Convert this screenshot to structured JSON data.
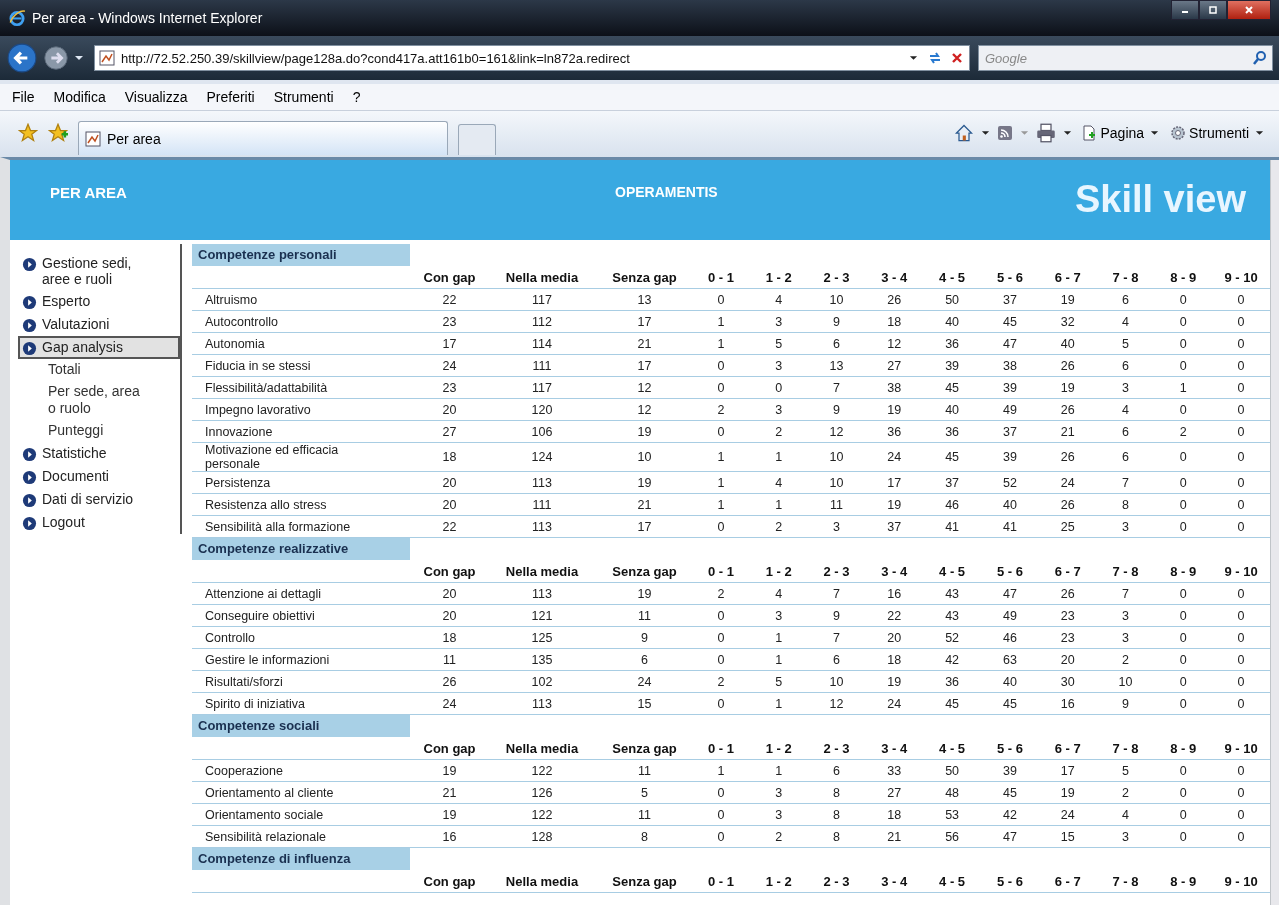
{
  "window": {
    "title": "Per area - Windows Internet Explorer"
  },
  "address_bar": {
    "url": "http://72.52.250.39/skillview/page128a.do?cond417a.att161b0=161&link=ln872a.redirect"
  },
  "search": {
    "placeholder": "Google"
  },
  "menu": [
    "File",
    "Modifica",
    "Visualizza",
    "Preferiti",
    "Strumenti",
    "?"
  ],
  "tabs": [
    {
      "label": "Per area",
      "selected": true
    }
  ],
  "toolbar": {
    "page_button": "Pagina",
    "tools_button": "Strumenti"
  },
  "page_header": {
    "section": "PER AREA",
    "company": "OPERAMENTIS",
    "logo": "Skill view"
  },
  "sidebar": {
    "items": [
      {
        "label": "Gestione sedi, aree e ruoli",
        "selected": false
      },
      {
        "label": "Esperto",
        "selected": false
      },
      {
        "label": "Valutazioni",
        "selected": false
      },
      {
        "label": "Gap analysis",
        "selected": true,
        "children": [
          {
            "label": "Totali",
            "selected": false
          },
          {
            "label": "Per sede, area o ruolo",
            "selected": false
          },
          {
            "label": "Punteggi",
            "selected": false
          }
        ]
      },
      {
        "label": "Statistiche",
        "selected": false
      },
      {
        "label": "Documenti",
        "selected": false
      },
      {
        "label": "Dati di servizio",
        "selected": false
      },
      {
        "label": "Logout",
        "selected": false
      }
    ]
  },
  "sections": [
    {
      "title": "Competenze personali",
      "columns": [
        "Con gap",
        "Nella media",
        "Senza gap",
        "0 - 1",
        "1 - 2",
        "2 - 3",
        "3 - 4",
        "4 - 5",
        "5 - 6",
        "6 - 7",
        "7 - 8",
        "8 - 9",
        "9 - 10"
      ],
      "rows": [
        {
          "name": "Altruismo",
          "values": [
            "22",
            "117",
            "13",
            "0",
            "4",
            "10",
            "26",
            "50",
            "37",
            "19",
            "6",
            "0",
            "0"
          ]
        },
        {
          "name": "Autocontrollo",
          "values": [
            "23",
            "112",
            "17",
            "1",
            "3",
            "9",
            "18",
            "40",
            "45",
            "32",
            "4",
            "0",
            "0"
          ]
        },
        {
          "name": "Autonomia",
          "values": [
            "17",
            "114",
            "21",
            "1",
            "5",
            "6",
            "12",
            "36",
            "47",
            "40",
            "5",
            "0",
            "0"
          ]
        },
        {
          "name": "Fiducia in se stessi",
          "values": [
            "24",
            "111",
            "17",
            "0",
            "3",
            "13",
            "27",
            "39",
            "38",
            "26",
            "6",
            "0",
            "0"
          ]
        },
        {
          "name": "Flessibilità/adattabilità",
          "values": [
            "23",
            "117",
            "12",
            "0",
            "0",
            "7",
            "38",
            "45",
            "39",
            "19",
            "3",
            "1",
            "0"
          ]
        },
        {
          "name": "Impegno lavorativo",
          "values": [
            "20",
            "120",
            "12",
            "2",
            "3",
            "9",
            "19",
            "40",
            "49",
            "26",
            "4",
            "0",
            "0"
          ]
        },
        {
          "name": "Innovazione",
          "values": [
            "27",
            "106",
            "19",
            "0",
            "2",
            "12",
            "36",
            "36",
            "37",
            "21",
            "6",
            "2",
            "0"
          ]
        },
        {
          "name": "Motivazione ed efficacia personale",
          "values": [
            "18",
            "124",
            "10",
            "1",
            "1",
            "10",
            "24",
            "45",
            "39",
            "26",
            "6",
            "0",
            "0"
          ]
        },
        {
          "name": "Persistenza",
          "values": [
            "20",
            "113",
            "19",
            "1",
            "4",
            "10",
            "17",
            "37",
            "52",
            "24",
            "7",
            "0",
            "0"
          ]
        },
        {
          "name": "Resistenza allo stress",
          "values": [
            "20",
            "111",
            "21",
            "1",
            "1",
            "11",
            "19",
            "46",
            "40",
            "26",
            "8",
            "0",
            "0"
          ]
        },
        {
          "name": "Sensibilità alla formazione",
          "values": [
            "22",
            "113",
            "17",
            "0",
            "2",
            "3",
            "37",
            "41",
            "41",
            "25",
            "3",
            "0",
            "0"
          ]
        }
      ]
    },
    {
      "title": "Competenze realizzative",
      "columns": [
        "Con gap",
        "Nella media",
        "Senza gap",
        "0 - 1",
        "1 - 2",
        "2 - 3",
        "3 - 4",
        "4 - 5",
        "5 - 6",
        "6 - 7",
        "7 - 8",
        "8 - 9",
        "9 - 10"
      ],
      "rows": [
        {
          "name": "Attenzione ai dettagli",
          "values": [
            "20",
            "113",
            "19",
            "2",
            "4",
            "7",
            "16",
            "43",
            "47",
            "26",
            "7",
            "0",
            "0"
          ]
        },
        {
          "name": "Conseguire obiettivi",
          "values": [
            "20",
            "121",
            "11",
            "0",
            "3",
            "9",
            "22",
            "43",
            "49",
            "23",
            "3",
            "0",
            "0"
          ]
        },
        {
          "name": "Controllo",
          "values": [
            "18",
            "125",
            "9",
            "0",
            "1",
            "7",
            "20",
            "52",
            "46",
            "23",
            "3",
            "0",
            "0"
          ]
        },
        {
          "name": "Gestire le informazioni",
          "values": [
            "11",
            "135",
            "6",
            "0",
            "1",
            "6",
            "18",
            "42",
            "63",
            "20",
            "2",
            "0",
            "0"
          ]
        },
        {
          "name": "Risultati/sforzi",
          "values": [
            "26",
            "102",
            "24",
            "2",
            "5",
            "10",
            "19",
            "36",
            "40",
            "30",
            "10",
            "0",
            "0"
          ]
        },
        {
          "name": "Spirito di iniziativa",
          "values": [
            "24",
            "113",
            "15",
            "0",
            "1",
            "12",
            "24",
            "45",
            "45",
            "16",
            "9",
            "0",
            "0"
          ]
        }
      ]
    },
    {
      "title": "Competenze sociali",
      "columns": [
        "Con gap",
        "Nella media",
        "Senza gap",
        "0 - 1",
        "1 - 2",
        "2 - 3",
        "3 - 4",
        "4 - 5",
        "5 - 6",
        "6 - 7",
        "7 - 8",
        "8 - 9",
        "9 - 10"
      ],
      "rows": [
        {
          "name": "Cooperazione",
          "values": [
            "19",
            "122",
            "11",
            "1",
            "1",
            "6",
            "33",
            "50",
            "39",
            "17",
            "5",
            "0",
            "0"
          ]
        },
        {
          "name": "Orientamento al cliente",
          "values": [
            "21",
            "126",
            "5",
            "0",
            "3",
            "8",
            "27",
            "48",
            "45",
            "19",
            "2",
            "0",
            "0"
          ]
        },
        {
          "name": "Orientamento sociale",
          "values": [
            "19",
            "122",
            "11",
            "0",
            "3",
            "8",
            "18",
            "53",
            "42",
            "24",
            "4",
            "0",
            "0"
          ]
        },
        {
          "name": "Sensibilità relazionale",
          "values": [
            "16",
            "128",
            "8",
            "0",
            "2",
            "8",
            "21",
            "56",
            "47",
            "15",
            "3",
            "0",
            "0"
          ]
        }
      ]
    },
    {
      "title": "Competenze di influenza",
      "columns": [
        "Con gap",
        "Nella media",
        "Senza gap",
        "0 - 1",
        "1 - 2",
        "2 - 3",
        "3 - 4",
        "4 - 5",
        "5 - 6",
        "6 - 7",
        "7 - 8",
        "8 - 9",
        "9 - 10"
      ]
    }
  ]
}
